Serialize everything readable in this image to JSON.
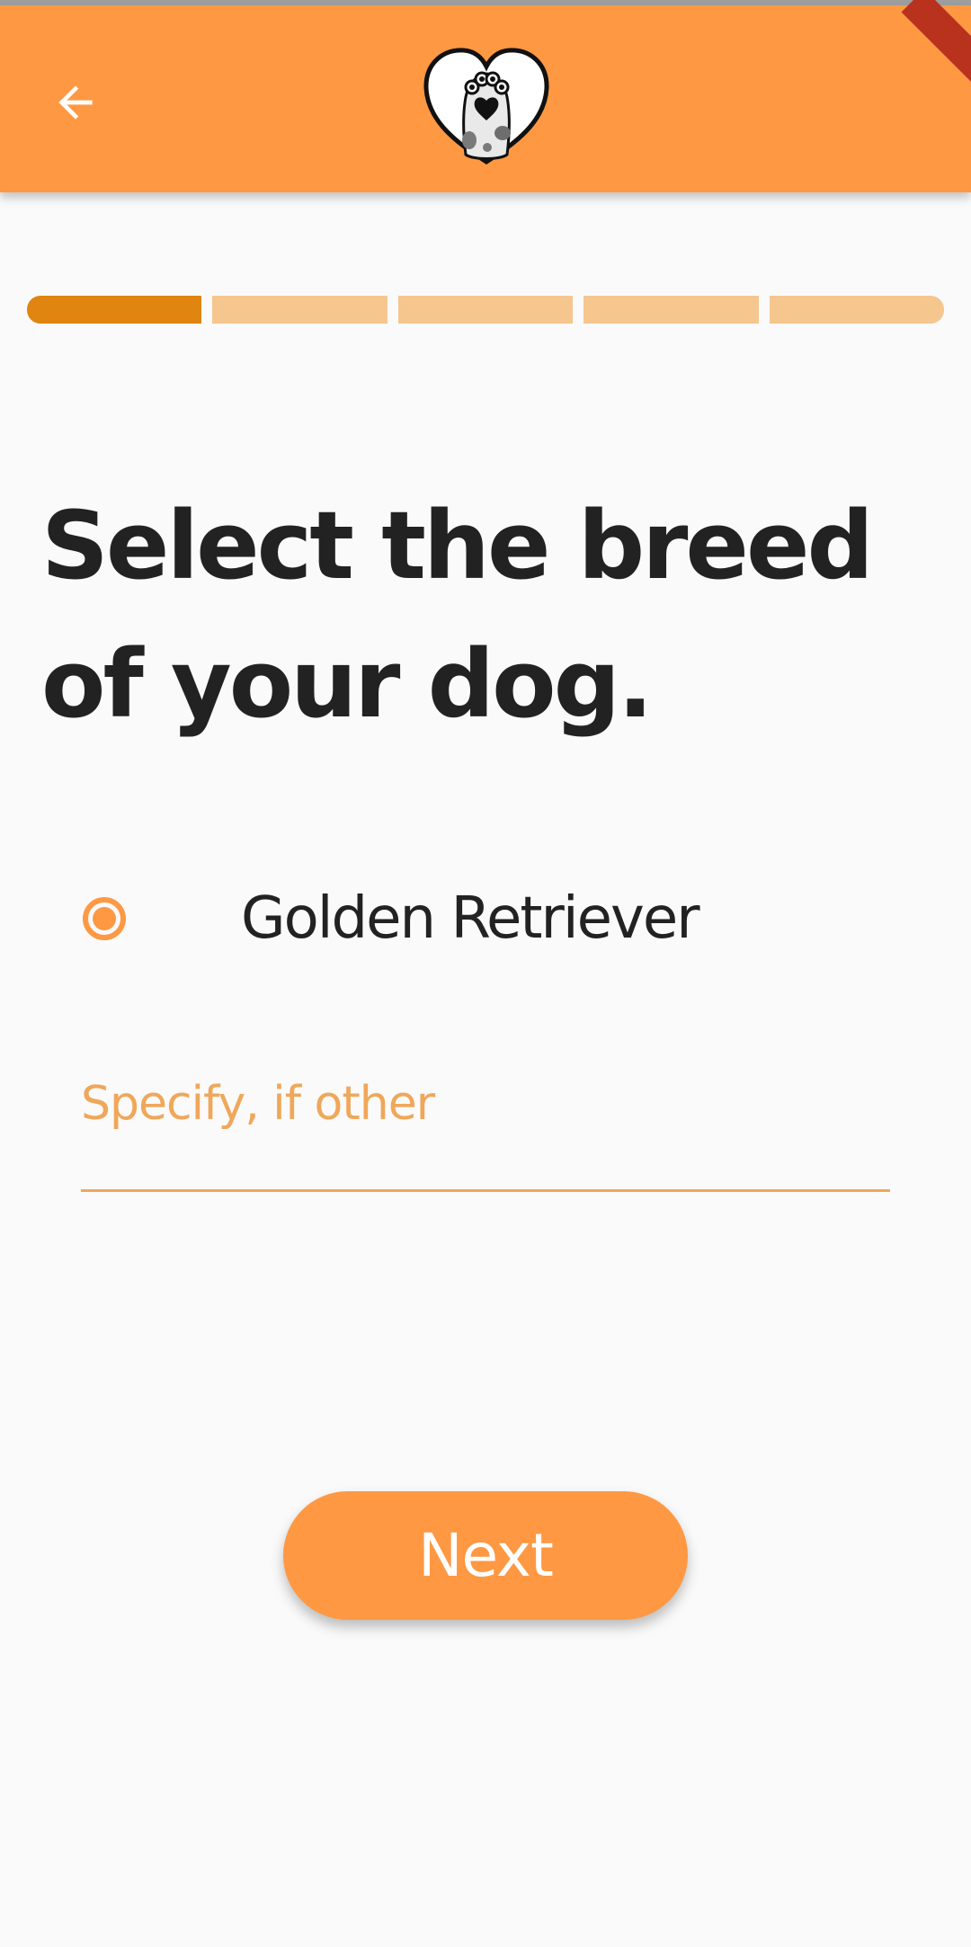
{
  "app_bar": {
    "back_icon": "arrow-left-icon",
    "logo_icon": "heart-dog-paw-logo",
    "background_color": "#ff9843"
  },
  "progress": {
    "total_steps": 5,
    "current_step": 1,
    "active_color": "#df8510",
    "inactive_color": "#f5c68e"
  },
  "question": {
    "title": "Select the breed of your dog."
  },
  "options": [
    {
      "label": "Golden Retriever",
      "selected": true
    }
  ],
  "other_field": {
    "placeholder": "Specify, if other",
    "value": ""
  },
  "actions": {
    "next_label": "Next"
  },
  "colors": {
    "accent": "#ff9843",
    "text": "#222222",
    "background": "#fafafa"
  }
}
